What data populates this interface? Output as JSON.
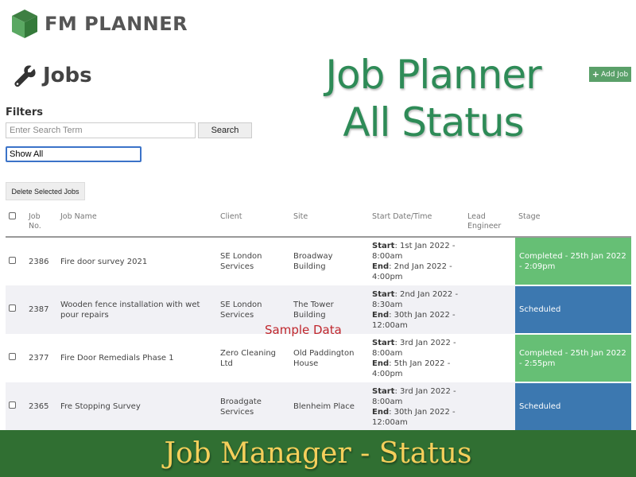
{
  "app": {
    "logo_text": "FM PLANNER",
    "brand_color": "#4a9a52"
  },
  "page": {
    "title": "Jobs",
    "title_icon": "wrench-icon"
  },
  "overlay": {
    "title_line1": "Job Planner",
    "title_line2": "All Status",
    "sample_label": "Sample Data",
    "footer_title": "Job Manager - Status"
  },
  "toolbar": {
    "add_job_label": "Add Job",
    "add_job_icon": "plus-icon",
    "delete_selected_label": "Delete Selected Jobs"
  },
  "filters": {
    "label": "Filters",
    "search_placeholder": "Enter Search Term",
    "search_value": "",
    "search_button_label": "Search",
    "status_selected": "Show All"
  },
  "table": {
    "headers": {
      "job_no_line1": "Job",
      "job_no_line2": "No.",
      "job_name": "Job Name",
      "client": "Client",
      "site": "Site",
      "start_date": "Start Date/Time",
      "lead_line1": "Lead",
      "lead_line2": "Engineer",
      "stage": "Stage"
    },
    "start_label": "Start",
    "end_label": "End",
    "rows": [
      {
        "job_no": "2386",
        "job_name": "Fire door survey 2021",
        "client": "SE London Services",
        "site": "Broadway Building",
        "start": "1st Jan 2022 - 8:00am",
        "end": "2nd Jan 2022 - 4:00pm",
        "lead_engineer": "",
        "stage": "Completed - 25th Jan 2022 - 2:09pm",
        "stage_status": "completed"
      },
      {
        "job_no": "2387",
        "job_name": "Wooden fence installation with wet pour repairs",
        "client": "SE London Services",
        "site": "The Tower Building",
        "start": "2nd Jan 2022 - 8:30am",
        "end": "30th Jan 2022 - 12:00am",
        "lead_engineer": "",
        "stage": "Scheduled",
        "stage_status": "scheduled"
      },
      {
        "job_no": "2377",
        "job_name": "Fire Door Remedials Phase 1",
        "client": "Zero Cleaning Ltd",
        "site": "Old Paddington House",
        "start": "3rd Jan 2022 - 8:00am",
        "end": "5th Jan 2022 - 4:00pm",
        "lead_engineer": "",
        "stage": "Completed - 25th Jan 2022 - 2:55pm",
        "stage_status": "completed"
      },
      {
        "job_no": "2365",
        "job_name": "Fre Stopping Survey",
        "client": "Broadgate Services",
        "site": "Blenheim Place",
        "start": "3rd Jan 2022 - 8:00am",
        "end": "30th Jan 2022 - 12:00am",
        "lead_engineer": "",
        "stage": "Scheduled",
        "stage_status": "scheduled"
      }
    ]
  },
  "colors": {
    "completed": "#66bf75",
    "scheduled": "#3c78b0",
    "title_green": "#2e8b57",
    "footer_bg": "#306f32",
    "footer_text": "#f5cf5b",
    "sample_red": "#c0272d"
  }
}
